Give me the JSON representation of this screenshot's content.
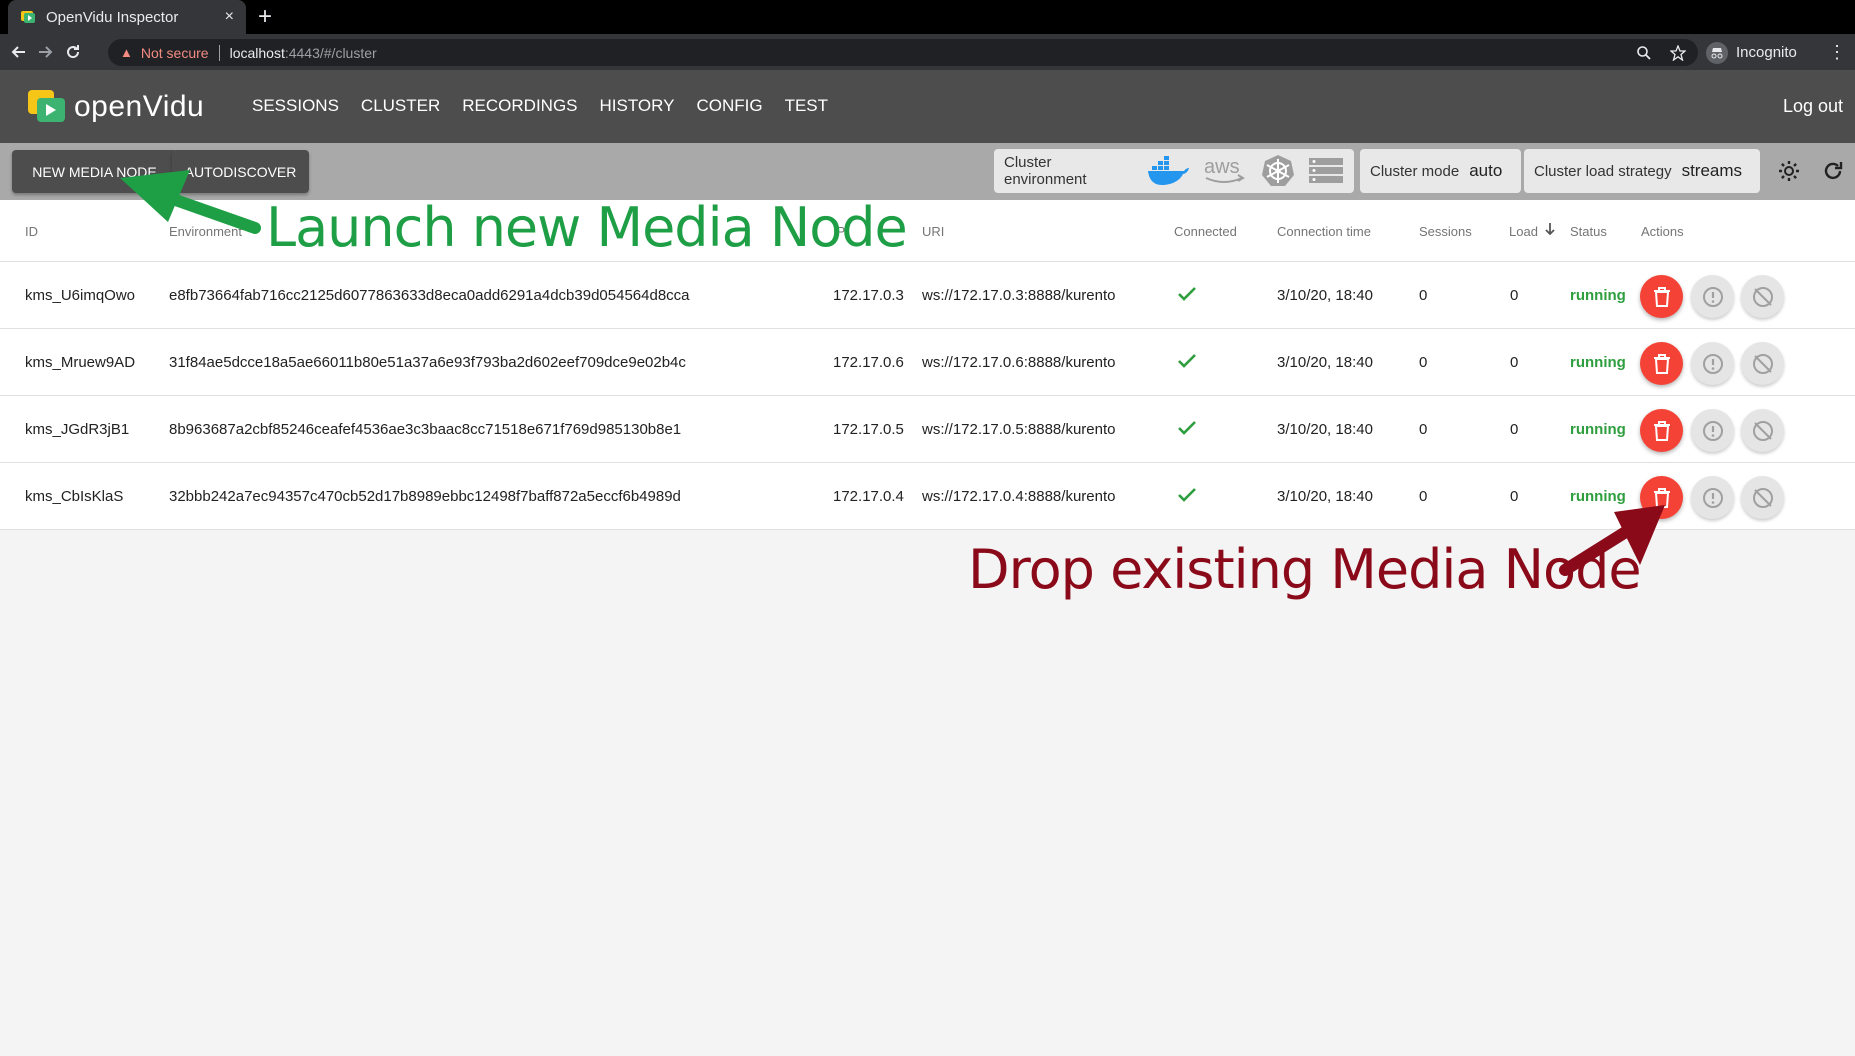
{
  "browser": {
    "tab_title": "OpenVidu Inspector",
    "tab_close": "×",
    "new_tab": "+",
    "not_secure": "Not secure",
    "url_host": "localhost",
    "url_path": ":4443/#/cluster",
    "incognito": "Incognito"
  },
  "app": {
    "brand": "openVidu",
    "nav": [
      "SESSIONS",
      "CLUSTER",
      "RECORDINGS",
      "HISTORY",
      "CONFIG",
      "TEST"
    ],
    "logout": "Log out"
  },
  "toolbar": {
    "new_media_node": "NEW MEDIA NODE",
    "autodiscover": "AUTODISCOVER",
    "cluster_environment_label": "Cluster environment",
    "cluster_environment_icons": [
      "docker-icon",
      "aws-icon",
      "kubernetes-icon",
      "server-icon"
    ],
    "cluster_mode_label": "Cluster mode",
    "cluster_mode_value": "auto",
    "load_strategy_label": "Cluster load strategy",
    "load_strategy_value": "streams"
  },
  "table": {
    "headers": {
      "id": "ID",
      "environment": "Environment",
      "ip": "IP",
      "uri": "URI",
      "connected": "Connected",
      "connection_time": "Connection time",
      "sessions": "Sessions",
      "load": "Load",
      "status": "Status",
      "actions": "Actions"
    },
    "rows": [
      {
        "id": "kms_U6imqOwo",
        "env": "e8fb73664fab716cc2125d6077863633d8eca0add6291a4dcb39d054564d8cca",
        "ip": "172.17.0.3",
        "uri": "ws://172.17.0.3:8888/kurento",
        "time": "3/10/20, 18:40",
        "sessions": "0",
        "load": "0",
        "status": "running"
      },
      {
        "id": "kms_Mruew9AD",
        "env": "31f84ae5dcce18a5ae66011b80e51a37a6e93f793ba2d602eef709dce9e02b4c",
        "ip": "172.17.0.6",
        "uri": "ws://172.17.0.6:8888/kurento",
        "time": "3/10/20, 18:40",
        "sessions": "0",
        "load": "0",
        "status": "running"
      },
      {
        "id": "kms_JGdR3jB1",
        "env": "8b963687a2cbf85246ceafef4536ae3c3baac8cc71518e671f769d985130b8e1",
        "ip": "172.17.0.5",
        "uri": "ws://172.17.0.5:8888/kurento",
        "time": "3/10/20, 18:40",
        "sessions": "0",
        "load": "0",
        "status": "running"
      },
      {
        "id": "kms_CbIsKlaS",
        "env": "32bbb242a7ec94357c470cb52d17b8989ebbc12498f7baff872a5eccf6b4989d",
        "ip": "172.17.0.4",
        "uri": "ws://172.17.0.4:8888/kurento",
        "time": "3/10/20, 18:40",
        "sessions": "0",
        "load": "0",
        "status": "running"
      }
    ]
  },
  "annotations": {
    "launch": "Launch new Media Node",
    "drop": "Drop existing Media Node",
    "launch_color": "#1e9f46",
    "drop_color": "#8b0a1a"
  },
  "colors": {
    "toolbar": "#4d4d4d",
    "subbar": "#a9a9a9",
    "status_running": "#2e9e3e",
    "drop_button": "#f44336"
  }
}
